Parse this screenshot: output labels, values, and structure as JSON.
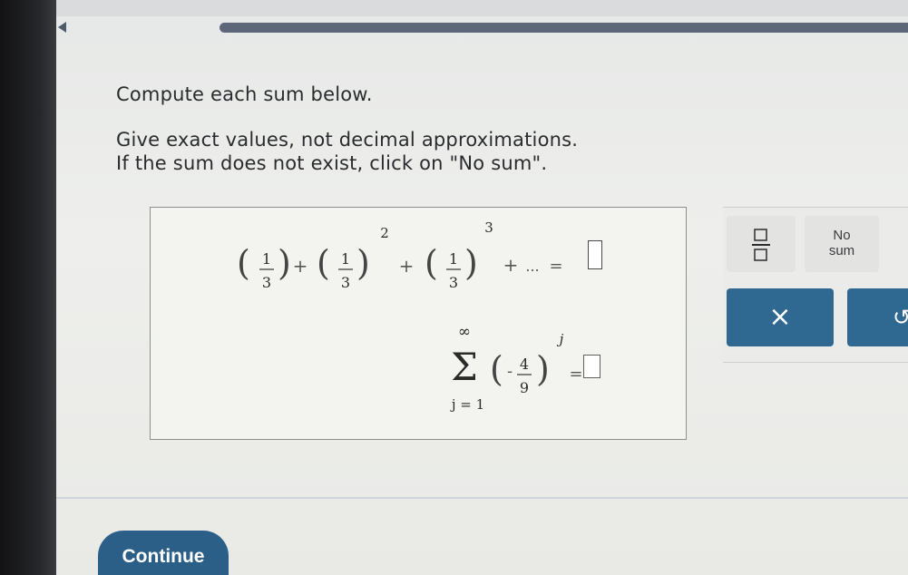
{
  "instructions": {
    "line1": "Compute each sum below.",
    "line2": "Give exact values, not decimal approximations.",
    "line3": "If the sum does not exist, click on \"No sum\"."
  },
  "problem1": {
    "term_numerator": "1",
    "term_denominator": "3",
    "exp2": "2",
    "exp3": "3",
    "plus": "+",
    "ellipsis": "...",
    "equals": "="
  },
  "problem2": {
    "upper": "∞",
    "sigma": "Σ",
    "lower": "j = 1",
    "minus": "-",
    "numerator": "4",
    "denominator": "9",
    "exponent": "j",
    "equals": "="
  },
  "keypad": {
    "no_sum_line1": "No",
    "no_sum_line2": "sum",
    "clear_label": "×",
    "undo_label": "↺"
  },
  "footer": {
    "continue_label": "Continue"
  },
  "colors": {
    "accent": "#2f6890",
    "progress": "#5d6778"
  }
}
